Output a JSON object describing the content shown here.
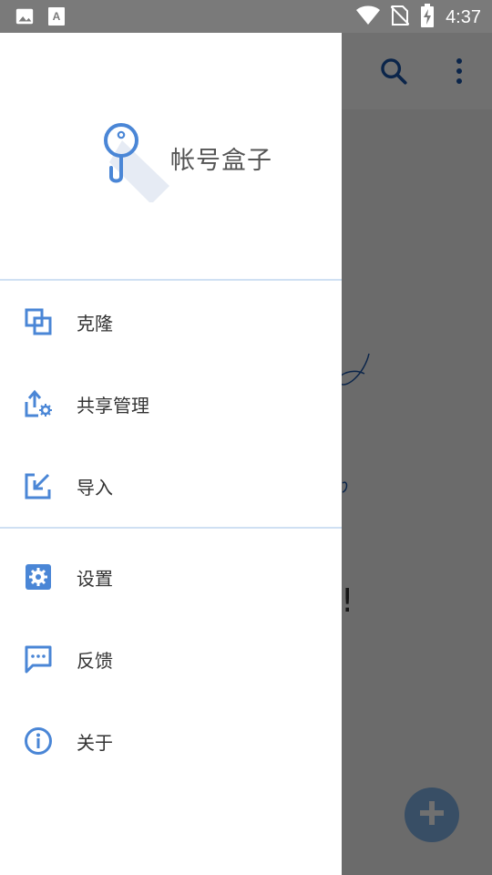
{
  "status_bar": {
    "time": "4:37",
    "left_icons": [
      "image-icon",
      "font-icon"
    ],
    "right_icons": [
      "wifi-icon",
      "no-sim-icon",
      "battery-charging-icon"
    ]
  },
  "background_app": {
    "toolbar_icons": [
      "search-icon",
      "more-vert-icon"
    ],
    "empty_message_fragment": "!",
    "fab_icon": "plus-icon"
  },
  "drawer": {
    "app_name": "帐号盒子",
    "logo_icon": "key-icon",
    "menu_group_1": [
      {
        "label": "克隆",
        "icon": "clone-icon"
      },
      {
        "label": "共享管理",
        "icon": "share-settings-icon"
      },
      {
        "label": "导入",
        "icon": "import-icon"
      }
    ],
    "menu_group_2": [
      {
        "label": "设置",
        "icon": "settings-icon"
      },
      {
        "label": "反馈",
        "icon": "feedback-icon"
      },
      {
        "label": "关于",
        "icon": "info-icon"
      }
    ]
  },
  "colors": {
    "accent": "#4a86d6",
    "divider": "#cfe0f3",
    "scrim": "rgba(0,0,0,0.56)"
  }
}
